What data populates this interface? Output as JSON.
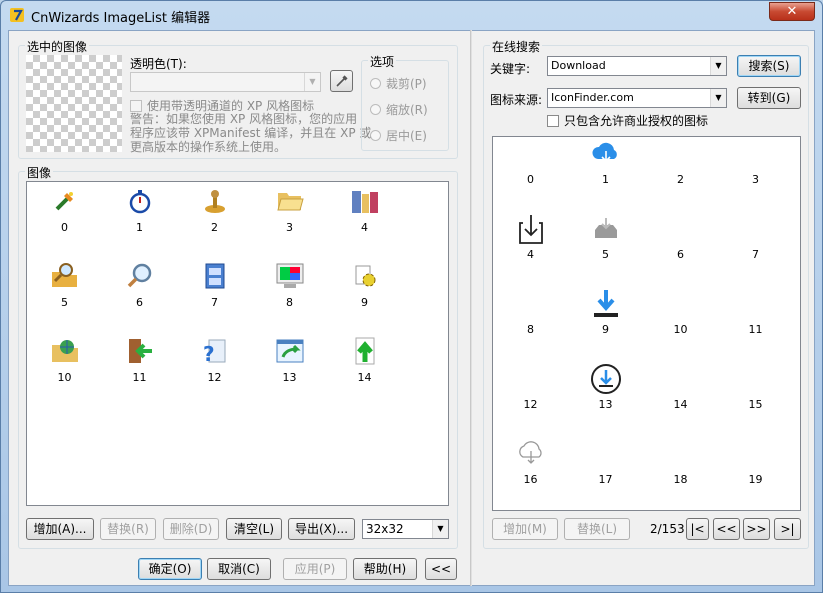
{
  "window": {
    "title": "CnWizards ImageList 编辑器",
    "close_label": "✕"
  },
  "selected": {
    "group_label": "选中的图像",
    "transparent_label": "透明色(T):",
    "alpha_checkbox": "使用带透明通道的 XP 风格图标",
    "warning_lines": [
      "警告：如果您使用 XP 风格图标，您的应用",
      "程序应该带 XPManifest 编译，并且在 XP 或",
      "更高版本的操作系统上使用。"
    ]
  },
  "options": {
    "group_label": "选项",
    "items": [
      "裁剪(P)",
      "缩放(R)",
      "居中(E)"
    ]
  },
  "images": {
    "group_label": "图像",
    "items": [
      {
        "label": "0",
        "icon": "wand-icon"
      },
      {
        "label": "1",
        "icon": "stopwatch-icon"
      },
      {
        "label": "2",
        "icon": "joystick-icon"
      },
      {
        "label": "3",
        "icon": "folder-open-icon"
      },
      {
        "label": "4",
        "icon": "library-books-icon"
      },
      {
        "label": "5",
        "icon": "search-folder-icon"
      },
      {
        "label": "6",
        "icon": "magnifier-icon"
      },
      {
        "label": "7",
        "icon": "cabinet-icon"
      },
      {
        "label": "8",
        "icon": "monitor-icon"
      },
      {
        "label": "9",
        "icon": "gear-document-icon"
      },
      {
        "label": "10",
        "icon": "folder-globe-icon"
      },
      {
        "label": "11",
        "icon": "exit-door-icon"
      },
      {
        "label": "12",
        "icon": "help-document-icon"
      },
      {
        "label": "13",
        "icon": "window-arrow-icon"
      },
      {
        "label": "14",
        "icon": "document-up-arrow-icon"
      }
    ]
  },
  "bottom_buttons": {
    "add": "增加(A)...",
    "replace": "替换(R)",
    "delete": "删除(D)",
    "clear": "清空(L)",
    "export": "导出(X)...",
    "size": "32x32"
  },
  "dialog_buttons": {
    "ok": "确定(O)",
    "cancel": "取消(C)",
    "apply": "应用(P)",
    "help": "帮助(H)",
    "collapse": "<<"
  },
  "online": {
    "group_label": "在线搜索",
    "keyword_label": "关键字:",
    "keyword_value": "Download",
    "search_button": "搜索(S)",
    "source_label": "图标来源:",
    "source_value": "IconFinder.com",
    "goto_button": "转到(G)",
    "commercial_checkbox": "只包含允许商业授权的图标",
    "results": [
      {
        "label": "0",
        "icon": ""
      },
      {
        "label": "1",
        "icon": "cloud-download-icon"
      },
      {
        "label": "2",
        "icon": ""
      },
      {
        "label": "3",
        "icon": ""
      },
      {
        "label": "4",
        "icon": "download-box-icon"
      },
      {
        "label": "5",
        "icon": "inbox-download-icon"
      },
      {
        "label": "6",
        "icon": ""
      },
      {
        "label": "7",
        "icon": ""
      },
      {
        "label": "8",
        "icon": ""
      },
      {
        "label": "9",
        "icon": "download-arrow-icon"
      },
      {
        "label": "10",
        "icon": ""
      },
      {
        "label": "11",
        "icon": ""
      },
      {
        "label": "12",
        "icon": ""
      },
      {
        "label": "13",
        "icon": "circle-download-icon"
      },
      {
        "label": "14",
        "icon": ""
      },
      {
        "label": "15",
        "icon": ""
      },
      {
        "label": "16",
        "icon": "cloud-outline-icon"
      },
      {
        "label": "17",
        "icon": ""
      },
      {
        "label": "18",
        "icon": ""
      },
      {
        "label": "19",
        "icon": ""
      }
    ],
    "add_button": "增加(M)",
    "replace_button": "替换(L)",
    "page_info": "2/153",
    "nav": [
      "|<",
      "<<",
      ">>",
      ">|"
    ]
  }
}
